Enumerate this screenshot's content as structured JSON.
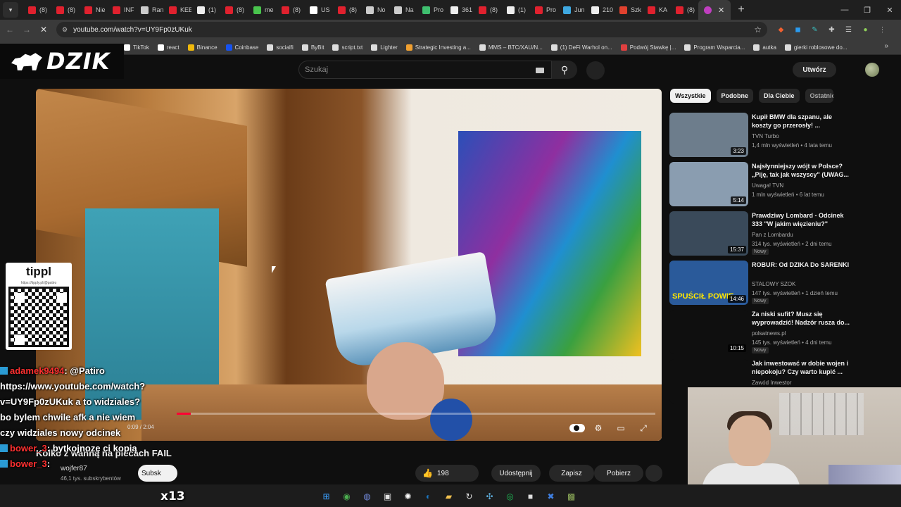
{
  "browser": {
    "tabs": [
      {
        "label": "(8)",
        "color": "#e0212e"
      },
      {
        "label": "(8)",
        "color": "#e0212e"
      },
      {
        "label": "Nie",
        "color": "#e0212e"
      },
      {
        "label": "INF",
        "color": "#e0212e"
      },
      {
        "label": "Ran",
        "color": "#cccccc"
      },
      {
        "label": "KEE",
        "color": "#e0212e"
      },
      {
        "label": "(1)",
        "color": "#eeeeee"
      },
      {
        "label": "(8)",
        "color": "#e0212e"
      },
      {
        "label": "me",
        "color": "#49c44d"
      },
      {
        "label": "(8)",
        "color": "#e0212e"
      },
      {
        "label": "US",
        "color": "#ffffff"
      },
      {
        "label": "(8)",
        "color": "#e0212e"
      },
      {
        "label": "No",
        "color": "#cccccc"
      },
      {
        "label": "Na",
        "color": "#cccccc"
      },
      {
        "label": "Pro",
        "color": "#3fbf6f"
      },
      {
        "label": "361",
        "color": "#eeeeee"
      },
      {
        "label": "(8)",
        "color": "#e0212e"
      },
      {
        "label": "(1)",
        "color": "#eeeeee"
      },
      {
        "label": "Pro",
        "color": "#e0212e"
      },
      {
        "label": "Jun",
        "color": "#3fa8e0"
      },
      {
        "label": "210",
        "color": "#eeeeee"
      },
      {
        "label": "Szk",
        "color": "#e0412e"
      },
      {
        "label": "KA",
        "color": "#e0212e"
      },
      {
        "label": "(8)",
        "color": "#e0212e"
      }
    ],
    "active_tab_close": "✕",
    "new_tab": "+",
    "url": "youtube.com/watch?v=UY9Fp0zUKuk",
    "window_controls": [
      "—",
      "❐",
      "✕"
    ]
  },
  "bookmarks": [
    {
      "label": "TikTok",
      "color": "#ffffff"
    },
    {
      "label": "react",
      "color": "#ffffff"
    },
    {
      "label": "Binance",
      "color": "#f0b90b"
    },
    {
      "label": "Coinbase",
      "color": "#1652f0"
    },
    {
      "label": "socialfi",
      "color": "#dddddd"
    },
    {
      "label": "ByBit",
      "color": "#dddddd"
    },
    {
      "label": "script.txt",
      "color": "#dddddd"
    },
    {
      "label": "Lighter",
      "color": "#dddddd"
    },
    {
      "label": "Strategic Investing a...",
      "color": "#f0a030"
    },
    {
      "label": "MMS – BTC/XAU/N...",
      "color": "#dddddd"
    },
    {
      "label": "(1) DeFi Warhol on...",
      "color": "#dddddd"
    },
    {
      "label": "Podwój Stawkę |...",
      "color": "#e04040"
    },
    {
      "label": "Program Wsparcia...",
      "color": "#dddddd"
    },
    {
      "label": "autka",
      "color": "#dddddd"
    },
    {
      "label": "gierki roblosowe do...",
      "color": "#dddddd"
    }
  ],
  "youtube": {
    "search_placeholder": "Szukaj",
    "create_label": "Utwórz",
    "video": {
      "title": "Kolko z wanną na plecach FAIL",
      "time": "0:09 / 2:04",
      "channel": "wojfer87",
      "subscribers": "46,1 tys. subskrybentów",
      "subscribe_label": "Subsk",
      "likes": "198",
      "share_label": "Udostępnij",
      "save_label": "Zapisz",
      "download_label": "Pobierz",
      "progress": 0.03
    },
    "chips": [
      "Wszystkie",
      "Podobne",
      "Dla Ciebie",
      "Ostatnio"
    ],
    "recommendations": [
      {
        "title": "Kupił BMW dla szpanu, ale koszty go przerosły! ...",
        "channel": "TVN Turbo",
        "meta": "1,4 mln wyświetleń • 4 lata temu",
        "duration": "3:23",
        "badge": "",
        "thumb_text": "",
        "thumb_color": "#6d7d8c"
      },
      {
        "title": "Najsłynniejszy wójt w Polsce? „Piję, tak jak wszyscy\" (UWAG...",
        "channel": "Uwaga! TVN",
        "meta": "1 mln wyświetleń • 6 lat temu",
        "duration": "5:14",
        "badge": "",
        "thumb_text": "",
        "thumb_color": "#8a9db0"
      },
      {
        "title": "Prawdziwy Lombard - Odcinek 333 \"W jakim więzieniu?\"",
        "channel": "Pan z Lombardu",
        "meta": "314 tys. wyświetleń • 2 dni temu",
        "duration": "15:37",
        "badge": "Nowy",
        "thumb_text": "",
        "thumb_color": "#3a4a5a"
      },
      {
        "title": "ROBUR: Od DZIKA Do SARENKI",
        "channel": "STALOWY SZOK",
        "meta": "147 tys. wyświetleń • 1 dzień temu",
        "duration": "14:46",
        "badge": "Nowy",
        "thumb_text": "SPUŚCIŁ POWIE",
        "thumb_color": "#2a5a9a"
      },
      {
        "title": "Za niski sufit? Musz się wyprowadzić! Nadzór rusza do...",
        "channel": "polsatnews.pl",
        "meta": "145 tys. wyświetleń • 4 dni temu",
        "duration": "10:15",
        "badge": "Nowy",
        "thumb_text": "",
        "thumb_color": "#0f0f0f"
      },
      {
        "title": "Jak inwestować w dobie wojen i niepokoju? Czy warto kupić ...",
        "channel": "Zawód Inwestor",
        "meta": "",
        "duration": "",
        "badge": "",
        "thumb_text": "",
        "thumb_color": "#0f0f0f"
      }
    ]
  },
  "overlay": {
    "logo": "DZIK",
    "tipply_title": "tippl",
    "tipply_url": "https://tipply.pl/@patiro",
    "chat": [
      {
        "user": "adamek9494",
        "text": ": @Patiro https://www.youtube.com/watch?v=UY9Fp0zUKuk a to widziales? bo bylem chwile afk a nie wiem czy widziales nowy odcinek"
      },
      {
        "user": "bower_3",
        "text": ": bytkojnozę ci kopią"
      },
      {
        "user": "bower_3",
        "text": ":"
      }
    ],
    "emote_text": "x13"
  },
  "taskbar": [
    {
      "icon": "windows-start-icon",
      "glyph": "⊞",
      "color": "#3aa0ff"
    },
    {
      "icon": "chrome-icon",
      "glyph": "◉",
      "color": "#4caf50"
    },
    {
      "icon": "discord-icon",
      "glyph": "◍",
      "color": "#7289da"
    },
    {
      "icon": "app-icon",
      "glyph": "▣",
      "color": "#e0e0e0"
    },
    {
      "icon": "openai-icon",
      "glyph": "✺",
      "color": "#ffffff"
    },
    {
      "icon": "steam-icon",
      "glyph": "◐",
      "color": "#1b76c0"
    },
    {
      "icon": "folder-icon",
      "glyph": "▰",
      "color": "#f2c14e"
    },
    {
      "icon": "refresh-icon",
      "glyph": "↻",
      "color": "#e0e0e0"
    },
    {
      "icon": "network-icon",
      "glyph": "✣",
      "color": "#5fb0e0"
    },
    {
      "icon": "spotify-icon",
      "glyph": "◎",
      "color": "#1db954"
    },
    {
      "icon": "box-icon",
      "glyph": "■",
      "color": "#e0e0e0"
    },
    {
      "icon": "x-app-icon",
      "glyph": "✖",
      "color": "#3f7fe0"
    },
    {
      "icon": "minecraft-icon",
      "glyph": "▩",
      "color": "#8fae5a"
    }
  ]
}
